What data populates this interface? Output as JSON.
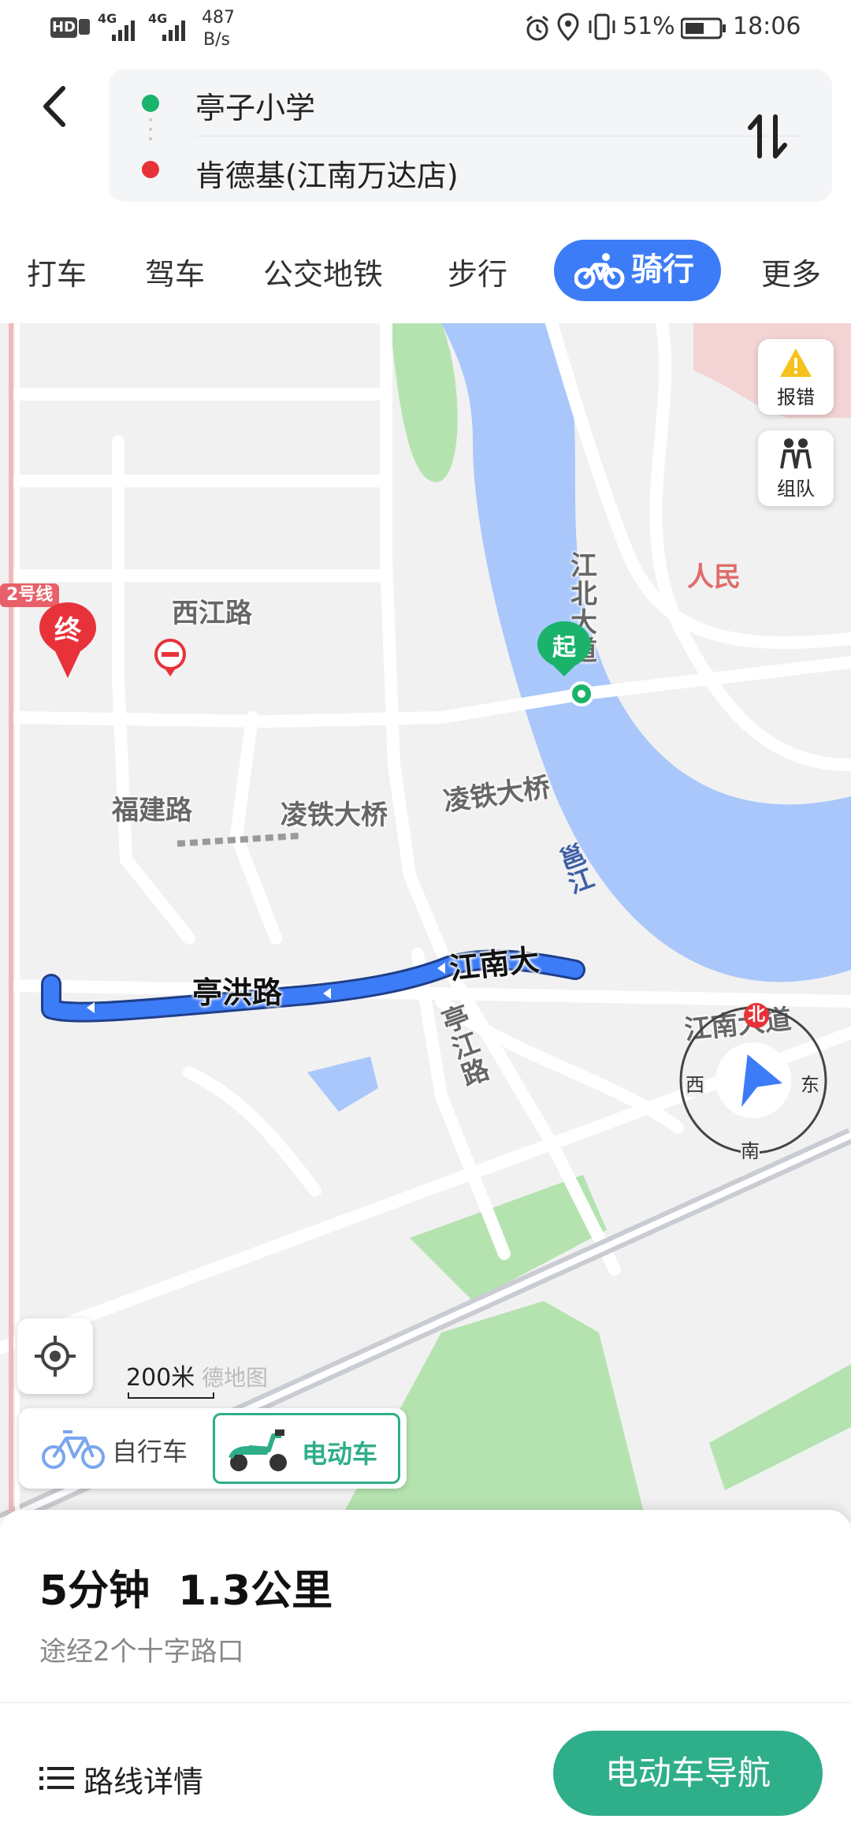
{
  "status_bar": {
    "hd": "HD",
    "net1": "4G",
    "net2": "4G",
    "speed_value": "487",
    "speed_unit": "B/s",
    "battery": "51%",
    "time": "18:06"
  },
  "route": {
    "origin": "亭子小学",
    "destination": "肯德基(江南万达店)",
    "origin_color": "#1bb36b",
    "destination_color": "#e8323a"
  },
  "tabs": [
    {
      "label": "打车"
    },
    {
      "label": "驾车"
    },
    {
      "label": "公交地铁"
    },
    {
      "label": "步行"
    },
    {
      "label": "骑行",
      "active": true
    },
    {
      "label": "更多"
    }
  ],
  "map": {
    "labels": {
      "metro": "2号线",
      "xijiang": "西江路",
      "fujian": "福建路",
      "lingtie1": "凌铁大桥",
      "lingtie2": "凌铁大桥",
      "jiangbei": "江北大道",
      "yong": "邕江",
      "renmin": "人民",
      "jiangnan_road": "江南大道",
      "tingjiang": "亭江路",
      "tinghong": "亭洪路",
      "jiangnan_route": "江南大",
      "watermark": "德地图"
    },
    "markers": {
      "end": "终",
      "start": "起"
    },
    "buttons": {
      "report": "报错",
      "team": "组队"
    },
    "compass": {
      "north": "北",
      "south": "南",
      "east": "东",
      "west": "西"
    },
    "scale": "200米",
    "vehicle_options": [
      {
        "label": "自行车",
        "active": false
      },
      {
        "label": "电动车",
        "active": true
      }
    ],
    "route_color": "#3d7cf7",
    "accent_green": "#2fae8a"
  },
  "summary": {
    "duration": "5分钟",
    "distance": "1.3公里",
    "via": "途经2个十字路口",
    "details_label": "路线详情",
    "navigate_label": "电动车导航"
  }
}
